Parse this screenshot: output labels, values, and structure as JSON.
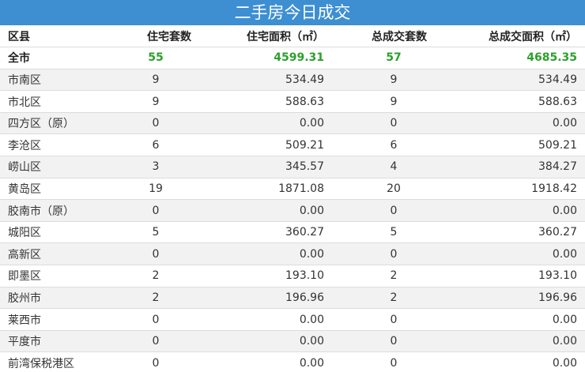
{
  "title": "二手房今日成交",
  "headers": [
    "区县",
    "住宅套数",
    "住宅面积（㎡）",
    "总成交套数",
    "总成交面积（㎡）"
  ],
  "colors": {
    "header_bg": "#3d8fd1",
    "total_green": "#2ca02c",
    "stripe": "#f2f2f2"
  },
  "rows": [
    [
      "全市",
      "55",
      "4599.31",
      "57",
      "4685.35"
    ],
    [
      "市南区",
      "9",
      "534.49",
      "9",
      "534.49"
    ],
    [
      "市北区",
      "9",
      "588.63",
      "9",
      "588.63"
    ],
    [
      "四方区（原）",
      "0",
      "0.00",
      "0",
      "0.00"
    ],
    [
      "李沧区",
      "6",
      "509.21",
      "6",
      "509.21"
    ],
    [
      "崂山区",
      "3",
      "345.57",
      "4",
      "384.27"
    ],
    [
      "黄岛区",
      "19",
      "1871.08",
      "20",
      "1918.42"
    ],
    [
      "胶南市（原）",
      "0",
      "0.00",
      "0",
      "0.00"
    ],
    [
      "城阳区",
      "5",
      "360.27",
      "5",
      "360.27"
    ],
    [
      "高新区",
      "0",
      "0.00",
      "0",
      "0.00"
    ],
    [
      "即墨区",
      "2",
      "193.10",
      "2",
      "193.10"
    ],
    [
      "胶州市",
      "2",
      "196.96",
      "2",
      "196.96"
    ],
    [
      "莱西市",
      "0",
      "0.00",
      "0",
      "0.00"
    ],
    [
      "平度市",
      "0",
      "0.00",
      "0",
      "0.00"
    ],
    [
      "前湾保税港区",
      "0",
      "0.00",
      "0",
      "0.00"
    ]
  ]
}
